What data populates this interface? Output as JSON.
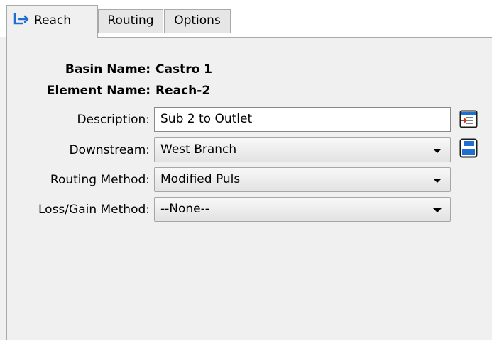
{
  "tabs": [
    {
      "label": "Reach",
      "icon": "reach-icon",
      "active": true
    },
    {
      "label": "Routing",
      "active": false
    },
    {
      "label": "Options",
      "active": false
    }
  ],
  "basin": {
    "label": "Basin Name:",
    "value": "Castro 1"
  },
  "element": {
    "label": "Element Name:",
    "value": "Reach-2"
  },
  "description": {
    "label": "Description:",
    "value": "Sub 2 to Outlet",
    "button_icon": "description-editor-icon"
  },
  "downstream": {
    "label": "Downstream:",
    "value": "West Branch",
    "button_icon": "select-element-icon"
  },
  "routing_method": {
    "label": "Routing Method:",
    "value": "Modified Puls"
  },
  "loss_gain_method": {
    "label": "Loss/Gain Method:",
    "value": "--None--"
  },
  "colors": {
    "panel_bg": "#f0f0f0",
    "icon_blue": "#1f6fd1",
    "icon_red": "#c0392b"
  }
}
